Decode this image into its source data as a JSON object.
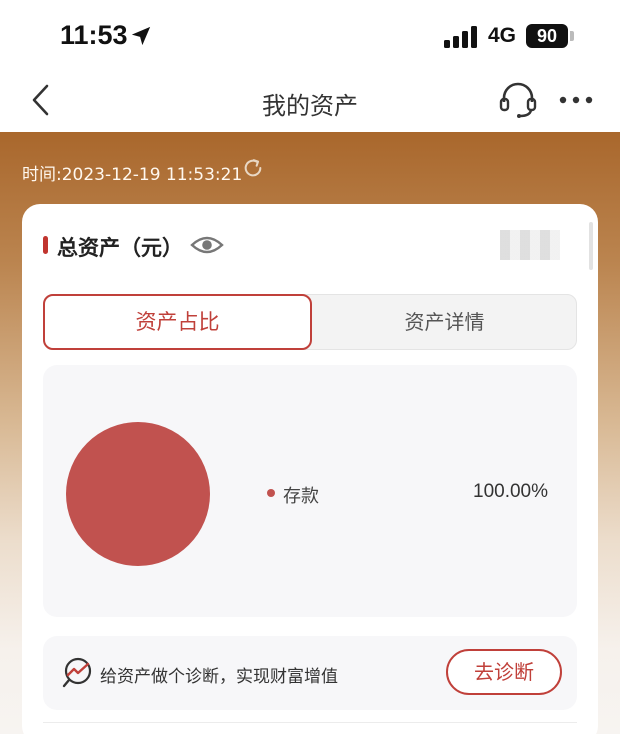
{
  "status_bar": {
    "time": "11:53",
    "network": "4G",
    "battery": "90"
  },
  "nav": {
    "title": "我的资产",
    "icons": [
      "back-arrow-icon",
      "customer-service-headset-icon",
      "more-dots-icon"
    ]
  },
  "asset": {
    "timestamp": "时间:2023-12-19 11:53:21",
    "total_label": "总资产（元）",
    "total_value_masked": true
  },
  "tabs": [
    {
      "label": "资产占比",
      "active": true
    },
    {
      "label": "资产详情",
      "active": false
    }
  ],
  "chart_data": {
    "type": "pie",
    "categories": [
      "存款"
    ],
    "values": [
      100.0
    ],
    "value_labels": [
      "100.00%"
    ],
    "colors": [
      "#c1524f"
    ]
  },
  "diagnosis": {
    "text": "给资产做个诊断，实现财富增值",
    "button_label": "去诊断"
  },
  "colors": {
    "accent": "#c0403a",
    "pie_slice": "#c1524f",
    "header_gradient_top": "#a9672c"
  }
}
